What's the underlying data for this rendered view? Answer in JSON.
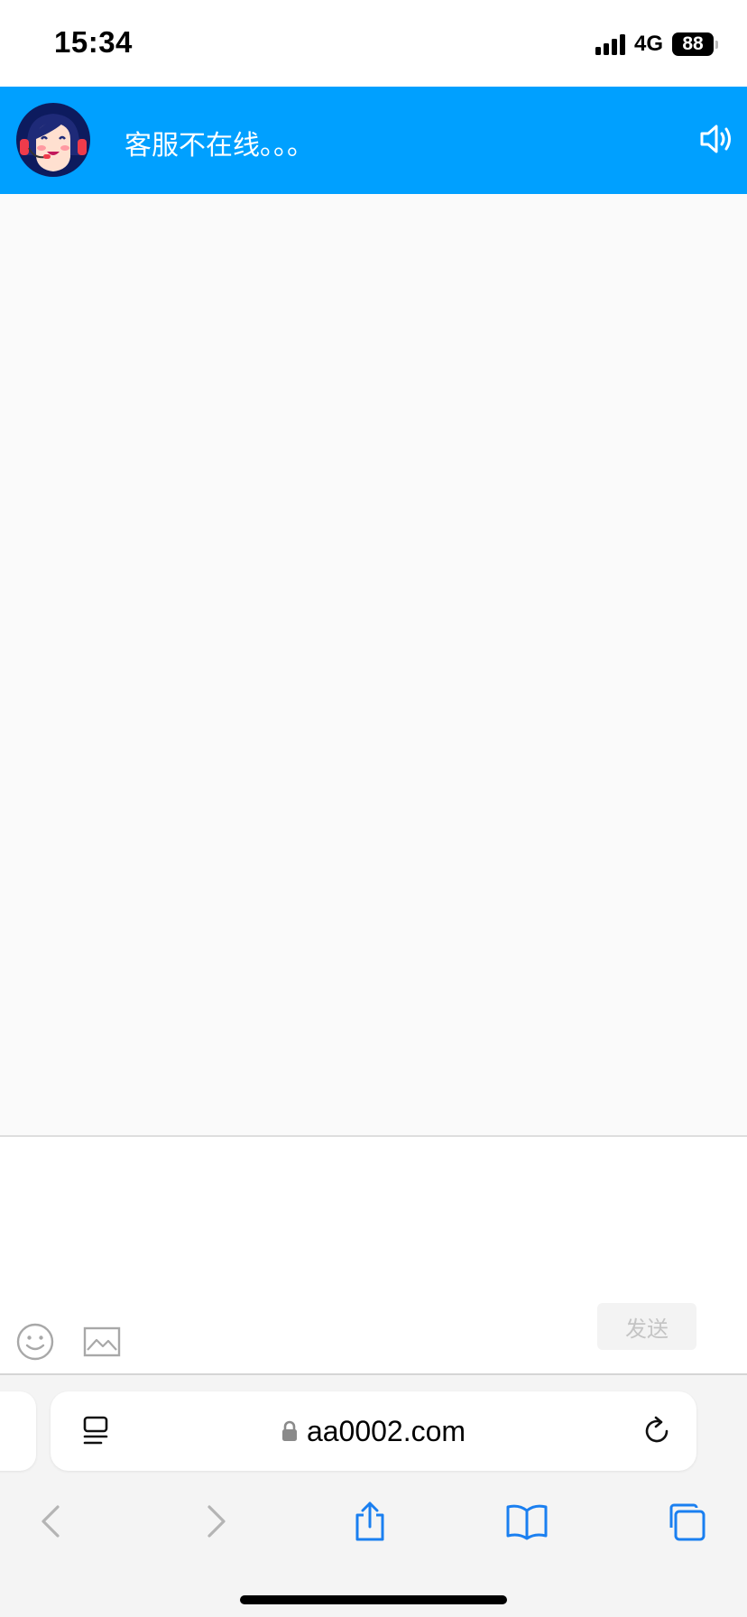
{
  "status_bar": {
    "time": "15:34",
    "network": "4G",
    "battery": "88"
  },
  "header": {
    "title": "客服不在线。。。",
    "avatar_icon": "agent-avatar-icon",
    "speaker_icon": "speaker-icon"
  },
  "composer": {
    "send_label": "发送",
    "emoji_icon": "emoji-icon",
    "image_icon": "image-icon"
  },
  "browser": {
    "url": "aa0002.com",
    "toolbar": [
      "back-icon",
      "forward-icon",
      "share-icon",
      "bookmarks-icon",
      "tabs-icon"
    ]
  },
  "colors": {
    "header_bg": "#00a0ff",
    "link_blue": "#1a7ff0",
    "disabled_gray": "#b4b4b4"
  }
}
